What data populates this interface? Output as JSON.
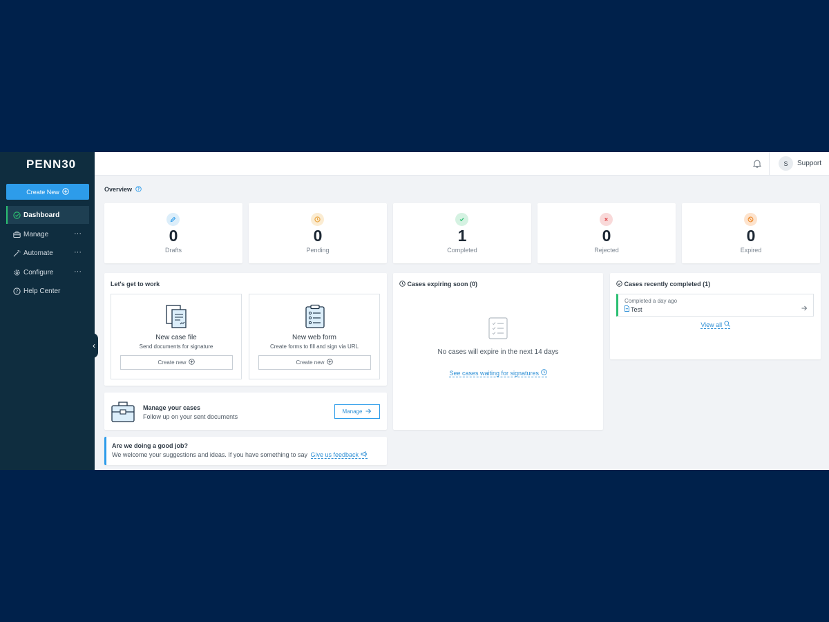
{
  "app": {
    "logo": "PENN30"
  },
  "sidebar": {
    "create_label": "Create New",
    "items": [
      {
        "label": "Dashboard"
      },
      {
        "label": "Manage",
        "more": "···"
      },
      {
        "label": "Automate",
        "more": "···"
      },
      {
        "label": "Configure",
        "more": "···"
      },
      {
        "label": "Help Center"
      }
    ]
  },
  "topbar": {
    "avatar_initial": "S",
    "user_name": "Support"
  },
  "overview": {
    "title": "Overview",
    "stats": [
      {
        "value": "0",
        "label": "Drafts",
        "color": "#2d9cea",
        "bg": "#dceefa",
        "icon": "pencil-icon"
      },
      {
        "value": "0",
        "label": "Pending",
        "color": "#e8a23a",
        "bg": "#fbecd2",
        "icon": "clock-icon"
      },
      {
        "value": "1",
        "label": "Completed",
        "color": "#2bbf72",
        "bg": "#d5f2e2",
        "icon": "check-icon"
      },
      {
        "value": "0",
        "label": "Rejected",
        "color": "#e0484b",
        "bg": "#f9d9d9",
        "icon": "x-icon"
      },
      {
        "value": "0",
        "label": "Expired",
        "color": "#ec8a2d",
        "bg": "#fde3cd",
        "icon": "ban-icon"
      }
    ]
  },
  "work": {
    "title": "Let's get to work",
    "case_file": {
      "title": "New case file",
      "desc": "Send documents for signature",
      "button": "Create new"
    },
    "web_form": {
      "title": "New web form",
      "desc": "Create forms to fill and sign via URL",
      "button": "Create new"
    }
  },
  "manage": {
    "title": "Manage your cases",
    "desc": "Follow up on your sent documents",
    "button": "Manage"
  },
  "feedback": {
    "title": "Are we doing a good job?",
    "desc": "We welcome your suggestions and ideas. If you have something to say",
    "link": "Give us feedback"
  },
  "expiring": {
    "title": "Cases expiring soon (0)",
    "empty": "No cases will expire in the next 14 days",
    "link": "See cases waiting for signatures"
  },
  "recent": {
    "title": "Cases recently completed (1)",
    "items": [
      {
        "meta": "Completed a day ago",
        "name": "Test"
      }
    ],
    "view_all": "View all"
  },
  "colors": {
    "accent": "#2d9cea",
    "success": "#2bbf72",
    "sidebar": "#0f2d3f",
    "backdrop": "#00214b"
  }
}
